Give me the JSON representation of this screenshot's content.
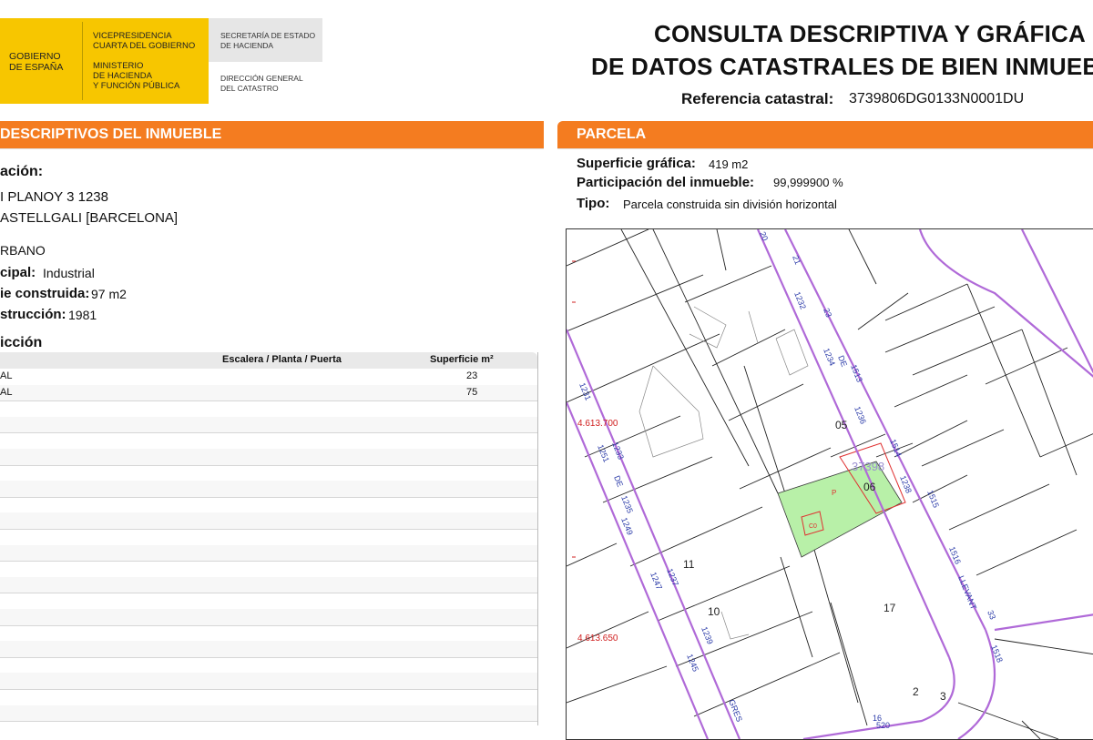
{
  "header": {
    "gov_name_1": "GOBIERNO",
    "gov_name_2": "DE ESPAÑA",
    "vice_1": "VICEPRESIDENCIA",
    "vice_2": "CUARTA DEL GOBIERNO",
    "min_1": "MINISTERIO",
    "min_2": "DE HACIENDA",
    "min_3": "Y FUNCIÓN PÚBLICA",
    "sec_1": "SECRETARÍA DE ESTADO",
    "sec_2": "DE HACIENDA",
    "dir_1": "DIRECCIÓN GENERAL",
    "dir_2": "DEL CATASTRO",
    "title_1": "CONSULTA DESCRIPTIVA Y GRÁFICA",
    "title_2": "DE DATOS CATASTRALES DE BIEN INMUEBLE",
    "ref_label": "Referencia catastral:",
    "ref_value": "3739806DG0133N0001DU"
  },
  "left": {
    "bar_title": "DESCRIPTIVOS DEL INMUEBLE",
    "location_label": "ación:",
    "address_1": "I PLANOY 3 1238",
    "address_2": "ASTELLGALI [BARCELONA]",
    "class_value": "RBANO",
    "use_label": "cipal:",
    "use_value": "Industrial",
    "surface_label": "ie construida:",
    "surface_value": "97 m2",
    "year_label": "strucción:",
    "year_value": "1981",
    "construction_heading": "icción",
    "table": {
      "headers": [
        "Escalera / Planta / Puerta",
        "Superficie m²"
      ],
      "rows": [
        {
          "use": "AL",
          "surface": "23"
        },
        {
          "use": "AL",
          "surface": "75"
        }
      ]
    }
  },
  "right": {
    "bar_title": "PARCELA",
    "graphic_surface_label": "Superficie gráfica:",
    "graphic_surface_value": "419 m2",
    "participation_label": "Participación del inmueble:",
    "participation_value": "99,999900 %",
    "type_label": "Tipo:",
    "type_value": "Parcela construida sin división horizontal"
  },
  "map": {
    "coord_1": "4.613.700",
    "coord_2": "4.613.650",
    "parcel_ref": "37398",
    "labels_black": [
      "05",
      "06",
      "11",
      "10",
      "17",
      "2",
      "3"
    ],
    "labels_blue": [
      "21",
      "23",
      "1232",
      "1234",
      "DE",
      "1513",
      "1236",
      "1514",
      "1238",
      "1515",
      "1516",
      "LLEVANT",
      "33",
      "1518",
      "1231",
      "1233",
      "1251",
      "DE",
      "1235",
      "1249",
      "1237",
      "1247",
      "1239",
      "1245",
      "GRES",
      "20",
      "16",
      "520"
    ],
    "labels_red": [
      "P",
      "C0"
    ],
    "colors": {
      "road": "#b06ad8",
      "parcel_fill": "#b8f0a8",
      "parcel_border": "#e03030",
      "coord": "#d02020",
      "number": "#2a3aa8"
    }
  }
}
